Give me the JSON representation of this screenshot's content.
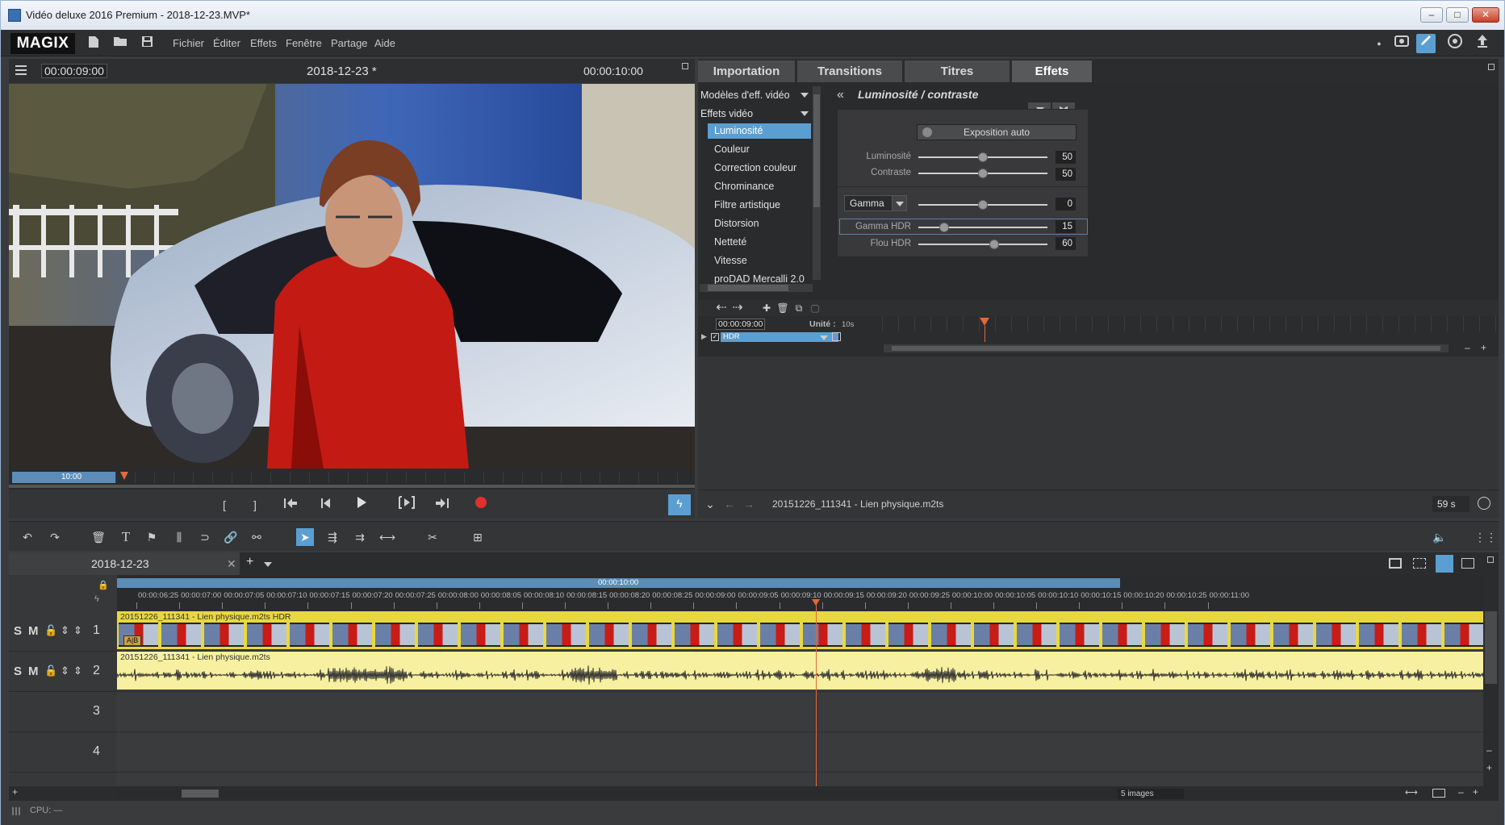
{
  "window": {
    "title": "Vidéo deluxe 2016 Premium - 2018-12-23.MVP*",
    "controls": [
      "–",
      "□",
      "✕"
    ]
  },
  "app": {
    "logo": "MAGIX"
  },
  "menu": [
    "Fichier",
    "Éditer",
    "Effets",
    "Fenêtre",
    "Partage",
    "Aide"
  ],
  "preview": {
    "timecode_left": "00:00:09:00",
    "project": "2018-12-23 *",
    "timecode_right": "00:00:10:00",
    "seek_label": "10:00",
    "bracket_left": "[",
    "bracket_right": "]"
  },
  "tabs": [
    {
      "label": "Importation",
      "active": false
    },
    {
      "label": "Transitions",
      "active": false
    },
    {
      "label": "Titres",
      "active": false
    },
    {
      "label": "Effets",
      "active": true
    }
  ],
  "effects": {
    "tree_header_1": "Modèles d'eff. vidéo",
    "tree_header_2": "Effets vidéo",
    "items": [
      {
        "label": "Luminosité",
        "selected": true
      },
      {
        "label": "Couleur"
      },
      {
        "label": "Correction couleur"
      },
      {
        "label": "Chrominance"
      },
      {
        "label": "Filtre artistique"
      },
      {
        "label": "Distorsion"
      },
      {
        "label": "Netteté"
      },
      {
        "label": "Vitesse"
      },
      {
        "label": "proDAD Mercalli 2.0"
      }
    ],
    "panel_title": "Luminosité / contraste",
    "auto_button": "Exposition auto",
    "params": [
      {
        "label": "Luminosité",
        "value": "50",
        "pos": 0.5
      },
      {
        "label": "Contraste",
        "value": "50",
        "pos": 0.5
      },
      {
        "label": "Gamma",
        "value": "0",
        "pos": 0.5
      },
      {
        "label": "Gamma HDR",
        "value": "15",
        "pos": 0.2
      },
      {
        "label": "Flou HDR",
        "value": "60",
        "pos": 0.6
      }
    ],
    "gamma_select": "Gamma"
  },
  "keyframes": {
    "timecode": "00:00:09:00",
    "unit_label": "Unité :",
    "unit_value": "10s",
    "track_label": "HDR"
  },
  "fx_footer": {
    "clip_name": "20151226_111341 - Lien physique.m2ts",
    "duration": "59 s"
  },
  "timeline": {
    "project_tab": "2018-12-23",
    "range_label": "00:00:10:00",
    "ruler_ticks": [
      "00:00:06:25",
      "00:00:07:00",
      "00:00:07:05",
      "00:00:07:10",
      "00:00:07:15",
      "00:00:07:20",
      "00:00:07:25",
      "00:00:08:00",
      "00:00:08:05",
      "00:00:08:10",
      "00:00:08:15",
      "00:00:08:20",
      "00:00:08:25",
      "00:00:09:00",
      "00:00:09:05",
      "00:00:09:10",
      "00:00:09:15",
      "00:00:09:20",
      "00:00:09:25",
      "00:00:10:00",
      "00:00:10:05",
      "00:00:10:10",
      "00:00:10:15",
      "00:00:10:20",
      "00:00:10:25",
      "00:00:11:00"
    ],
    "tracks": [
      {
        "num": "1",
        "clip": "20151226_111341 - Lien physique.m2ts   HDR"
      },
      {
        "num": "2",
        "clip": "20151226_111341 - Lien physique.m2ts"
      },
      {
        "num": "3",
        "clip": ""
      },
      {
        "num": "4",
        "clip": ""
      }
    ],
    "track_buttons": {
      "solo": "S",
      "mute": "M"
    },
    "zoom_select": "5 images"
  },
  "status": {
    "cpu": "CPU: —"
  },
  "colors": {
    "accent": "#5b9fd2",
    "video_clip": "#f0e060",
    "audio_clip": "#f7f0a0",
    "playhead": "#e06a3a",
    "record": "#e03030"
  }
}
